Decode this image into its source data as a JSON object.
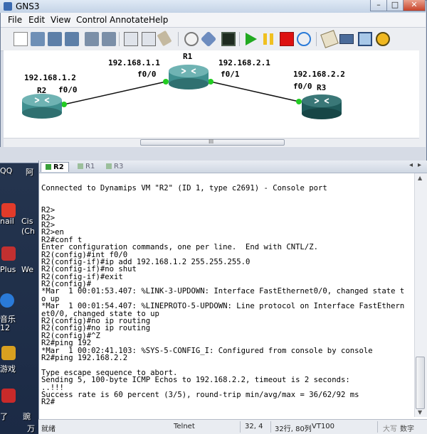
{
  "window": {
    "title": "GNS3",
    "controls": {
      "minimize": "–",
      "maximize": "□",
      "close": "✕"
    }
  },
  "menu": [
    "File",
    "Edit",
    "View",
    "Control",
    "Annotate",
    "Help"
  ],
  "toolbar_icons": [
    "new-file-icon",
    "open-folder-icon",
    "save-icon",
    "save-as-icon",
    "import-icon",
    "export-icon",
    "snapshot-icon",
    "show-hostnames-icon",
    "show-interfaces-icon",
    "eraser-icon",
    "console-all-icon",
    "capture-icon",
    "terminal-icon",
    "start-icon",
    "pause-icon",
    "stop-icon",
    "reload-icon",
    "add-note-icon",
    "insert-picture-icon",
    "draw-rectangle-icon",
    "draw-ellipse-icon"
  ],
  "topology": {
    "routers": [
      {
        "name": "R2",
        "ip": "192.168.1.2",
        "iface": "f0/0"
      },
      {
        "name": "R1",
        "ip_left": "192.168.1.1",
        "iface_left": "f0/0",
        "ip_right": "192.168.2.1",
        "iface_right": "f0/1"
      },
      {
        "name": "R3",
        "ip": "192.168.2.2",
        "iface": "f0/0"
      }
    ],
    "scroll_grip": "III"
  },
  "console": {
    "tabs": [
      "R2",
      "R1",
      "R3"
    ],
    "lines": [
      "Connected to Dynamips VM \"R2\" (ID 1, type c2691) - Console port",
      "",
      "",
      "R2>",
      "R2>",
      "R2>",
      "R2>en",
      "R2#conf t",
      "Enter configuration commands, one per line.  End with CNTL/Z.",
      "R2(config)#int f0/0",
      "R2(config-if)#ip add 192.168.1.2 255.255.255.0",
      "R2(config-if)#no shut",
      "R2(config-if)#exit",
      "R2(config)#",
      "*Mar  1 00:01:53.407: %LINK-3-UPDOWN: Interface FastEthernet0/0, changed state t",
      "o up",
      "*Mar  1 00:01:54.407: %LINEPROTO-5-UPDOWN: Line protocol on Interface FastEthern",
      "et0/0, changed state to up",
      "R2(config)#no ip routing",
      "R2(config)#no ip routing",
      "R2(config)#^Z",
      "R2#ping 192",
      "*Mar  1 00:02:41.103: %SYS-5-CONFIG_I: Configured from console by console",
      "R2#ping 192.168.2.2",
      "",
      "Type escape sequence to abort.",
      "Sending 5, 100-byte ICMP Echos to 192.168.2.2, timeout is 2 seconds:",
      "..!!!",
      "Success rate is 60 percent (3/5), round-trip min/avg/max = 36/62/92 ms",
      "R2#"
    ]
  },
  "statusbar": {
    "ready": "就绪",
    "protocol": "Telnet",
    "cursor": "32,  4",
    "size": "32行, 80列",
    "terminal": "VT100",
    "caps": "大写",
    "num": "数字"
  },
  "desktop_icons": [
    {
      "label": "QQ"
    },
    {
      "label": "阿"
    },
    {
      "label": "nail"
    },
    {
      "label": "Cis"
    },
    {
      "label": "(Ch"
    },
    {
      "label": "Plus"
    },
    {
      "label": "We"
    },
    {
      "label": "音乐"
    },
    {
      "label": "12"
    },
    {
      "label": "游戏"
    },
    {
      "label": "了"
    },
    {
      "label": "豌"
    },
    {
      "label": "万"
    }
  ],
  "colors": {
    "link_dot": "#22cc22",
    "router_teal": "#3f8f8f",
    "router_dark": "#1f5a5a",
    "start_green": "#22aa22",
    "pause_yellow": "#f0c020",
    "stop_red": "#dd1111"
  }
}
